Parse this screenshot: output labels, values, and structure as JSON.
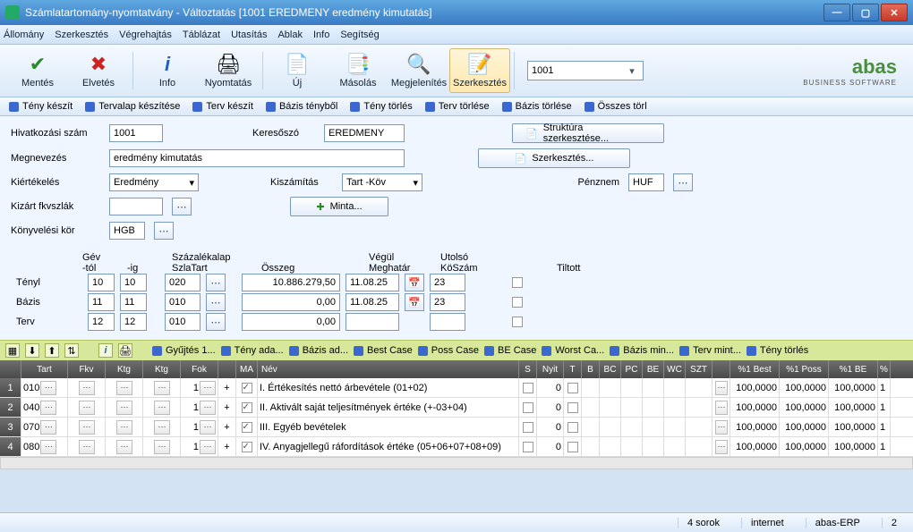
{
  "titlebar": "Számlatartomány-nyomtatvány - Változtatás  [1001   EREDMENY   eredmény kimutatás]",
  "menubar": [
    "Állomány",
    "Szerkesztés",
    "Végrehajtás",
    "Táblázat",
    "Utasítás",
    "Ablak",
    "Info",
    "Segítség"
  ],
  "toolbar": {
    "save": "Mentés",
    "discard": "Elvetés",
    "info": "Info",
    "print": "Nyomtatás",
    "new": "Új",
    "copy": "Másolás",
    "show": "Megjelenítés",
    "edit": "Szerkesztés",
    "combo": "1001"
  },
  "logo": {
    "brand": "abas",
    "sub": "BUSINESS SOFTWARE"
  },
  "strip": [
    "Tény készít",
    "Tervalap készítése",
    "Terv készít",
    "Bázis tényből",
    "Tény törlés",
    "Terv törlése",
    "Bázis törlése",
    "Összes törl"
  ],
  "form": {
    "hivatkozasi_szam_lbl": "Hivatkozási szám",
    "hivatkozasi_szam": "1001",
    "keresoszo_lbl": "Keresőszó",
    "keresoszo": "EREDMENY",
    "megnevezes_lbl": "Megnevezés",
    "megnevezes": "eredmény kimutatás",
    "kiertekeles_lbl": "Kiértékelés",
    "kiertekeles": "Eredmény",
    "kiszamitas_lbl": "Kiszámítás",
    "kiszamitas": "Tart -Köv",
    "kizart_lbl": "Kizárt fkvszlák",
    "minta_btn": "Minta...",
    "konyv_lbl": "Könyvelési kör",
    "konyv": "HGB",
    "penznem_lbl": "Pénznem",
    "penznem": "HUF",
    "struktura_btn": "Struktúra szerkesztése...",
    "szerk_btn": "Szerkesztés..."
  },
  "summary": {
    "hdr_gev_tol": "Gév\n-tól",
    "hdr_gev_ig": "-ig",
    "hdr_szazalek": "Százalékalap\nSzlaTart",
    "hdr_osszeg": "Összeg",
    "hdr_vegul": "Végül\nMeghatár",
    "hdr_utolso": "Utolsó\nKöSzám",
    "hdr_tiltott": "Tiltott",
    "rows": [
      {
        "lbl": "Tényl",
        "tol": "10",
        "ig": "10",
        "szt": "020",
        "osszeg": "10.886.279,50",
        "vegul": "11.08.25",
        "kosz": "23"
      },
      {
        "lbl": "Bázis",
        "tol": "11",
        "ig": "11",
        "szt": "010",
        "osszeg": "0,00",
        "vegul": "11.08.25",
        "kosz": "23"
      },
      {
        "lbl": "Terv",
        "tol": "12",
        "ig": "12",
        "szt": "010",
        "osszeg": "0,00",
        "vegul": "",
        "kosz": ""
      }
    ]
  },
  "midstrip": [
    "Gyűjtés 1...",
    "Tény ada...",
    "Bázis ad...",
    "Best Case",
    "Poss Case",
    "BE Case",
    "Worst Ca...",
    "Bázis min...",
    "Terv mint...",
    "Tény törlés"
  ],
  "grid": {
    "cols": [
      "",
      "Tart",
      "Fkv",
      "Ktg",
      "Ktg",
      "Fok",
      "",
      "MA",
      "Név",
      "S",
      "Nyit",
      "T",
      "B",
      "BC",
      "PC",
      "BE",
      "WC",
      "SZT",
      "",
      "%1 Best",
      "%1 Poss",
      "%1 BE",
      "%"
    ],
    "rows": [
      {
        "n": "1",
        "tart": "010",
        "ma": "1",
        "nev": "I. Értékesítés nettó árbevétele (01+02)",
        "nyit": "0",
        "b1": "100,0000",
        "b2": "100,0000",
        "b3": "100,0000",
        "b4": "1"
      },
      {
        "n": "2",
        "tart": "040",
        "ma": "1",
        "nev": "II. Aktivált saját teljesítmények értéke (+-03+04)",
        "nyit": "0",
        "b1": "100,0000",
        "b2": "100,0000",
        "b3": "100,0000",
        "b4": "1"
      },
      {
        "n": "3",
        "tart": "070",
        "ma": "1",
        "nev": "III. Egyéb bevételek",
        "nyit": "0",
        "b1": "100,0000",
        "b2": "100,0000",
        "b3": "100,0000",
        "b4": "1"
      },
      {
        "n": "4",
        "tart": "080",
        "ma": "1",
        "nev": "IV. Anyagjellegű ráfordítások értéke (05+06+07+08+09)",
        "nyit": "0",
        "b1": "100,0000",
        "b2": "100,0000",
        "b3": "100,0000",
        "b4": "1"
      }
    ]
  },
  "status": {
    "rows": "4 sorok",
    "net": "internet",
    "app": "abas-ERP",
    "num": "2"
  }
}
